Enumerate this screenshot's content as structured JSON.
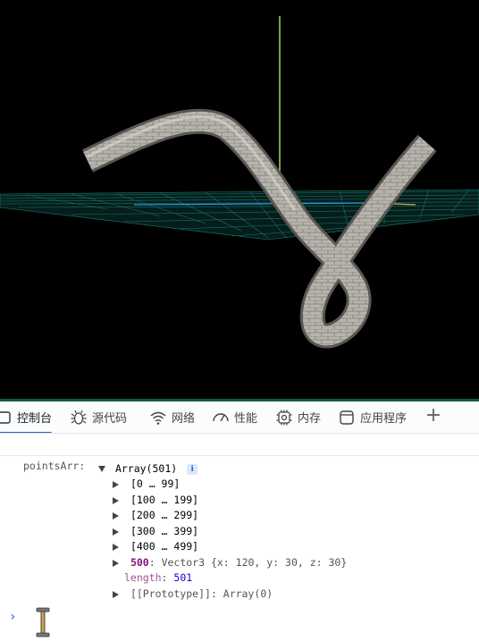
{
  "tabs": [
    {
      "label": "控制台",
      "icon": "console-icon"
    },
    {
      "label": "源代码",
      "icon": "bug-icon"
    },
    {
      "label": "网络",
      "icon": "wifi-icon"
    },
    {
      "label": "性能",
      "icon": "performance-icon"
    },
    {
      "label": "内存",
      "icon": "memory-chip-icon"
    },
    {
      "label": "应用程序",
      "icon": "application-icon"
    }
  ],
  "add_tab_label": "+",
  "console": {
    "var_name": "pointsArr:",
    "array_summary": "Array(501)",
    "info_badge": "i",
    "groups": [
      "[0 … 99]",
      "[100 … 199]",
      "[200 … 299]",
      "[300 … 399]",
      "[400 … 499]"
    ],
    "last_index": "500",
    "last_value": ": Vector3 {x: 120, y: 30, z: 30}",
    "length_key": "length",
    "length_value": "501",
    "prototype": "[[Prototype]]: Array(0)",
    "prompt": "›"
  },
  "colors": {
    "viewport_bg": "#000000",
    "grid": "#1f8f86",
    "axis_y": "#a6d46a",
    "tab_active_underline": "#1f62c7"
  }
}
